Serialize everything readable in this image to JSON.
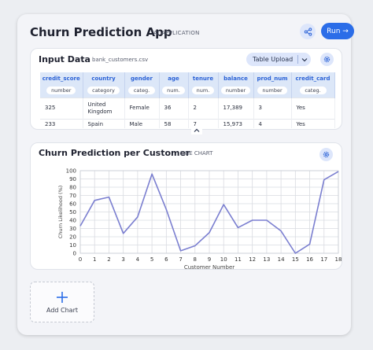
{
  "app": {
    "title": "Churn Prediction App",
    "subtitle": "AI APPLICATION",
    "run_label": "Run →",
    "accent": "#2b6de8"
  },
  "input_card": {
    "title": "Input Data",
    "filename": "bank_customers.csv",
    "upload_label": "Table Upload",
    "columns": [
      "credit_score",
      "country",
      "gender",
      "age",
      "tenure",
      "balance",
      "prod_num",
      "credit_card"
    ],
    "types": [
      "number",
      "category",
      "categ.",
      "num.",
      "num.",
      "number",
      "number",
      "categ."
    ],
    "rows": [
      [
        "325",
        "United Kingdom",
        "Female",
        "36",
        "2",
        "17,389",
        "3",
        "Yes"
      ],
      [
        "233",
        "Spain",
        "Male",
        "58",
        "7",
        "15,973",
        "4",
        "Yes"
      ]
    ]
  },
  "chart_card": {
    "title": "Churn Prediction per Customer",
    "subtitle": "LINE CHART"
  },
  "chart_data": {
    "type": "line",
    "title": "Churn Prediction per Customer",
    "xlabel": "Customer Number",
    "ylabel": "Churn Likelihood (%)",
    "x": [
      0,
      1,
      2,
      3,
      4,
      5,
      6,
      7,
      8,
      9,
      10,
      11,
      12,
      13,
      14,
      15,
      16,
      17,
      18
    ],
    "y": [
      33,
      64,
      68,
      24,
      44,
      96,
      53,
      3,
      9,
      25,
      59,
      31,
      40,
      40,
      27,
      0,
      11,
      89,
      99
    ],
    "xlim": [
      0,
      18
    ],
    "ylim": [
      0,
      100
    ],
    "yticks": [
      0,
      10,
      20,
      30,
      40,
      50,
      60,
      70,
      80,
      90,
      100
    ],
    "xticks": [
      0,
      1,
      2,
      3,
      4,
      5,
      6,
      7,
      8,
      9,
      10,
      11,
      12,
      13,
      14,
      15,
      16,
      17,
      18
    ],
    "grid": true,
    "line_color": "#7b7fd0"
  },
  "add_chart": {
    "label": "Add Chart"
  },
  "icons": {
    "share": "share-icon",
    "gear": "gear-icon",
    "chevron": "chevron-down-icon",
    "collapse": "chevron-up-icon",
    "plus": "plus-icon"
  }
}
